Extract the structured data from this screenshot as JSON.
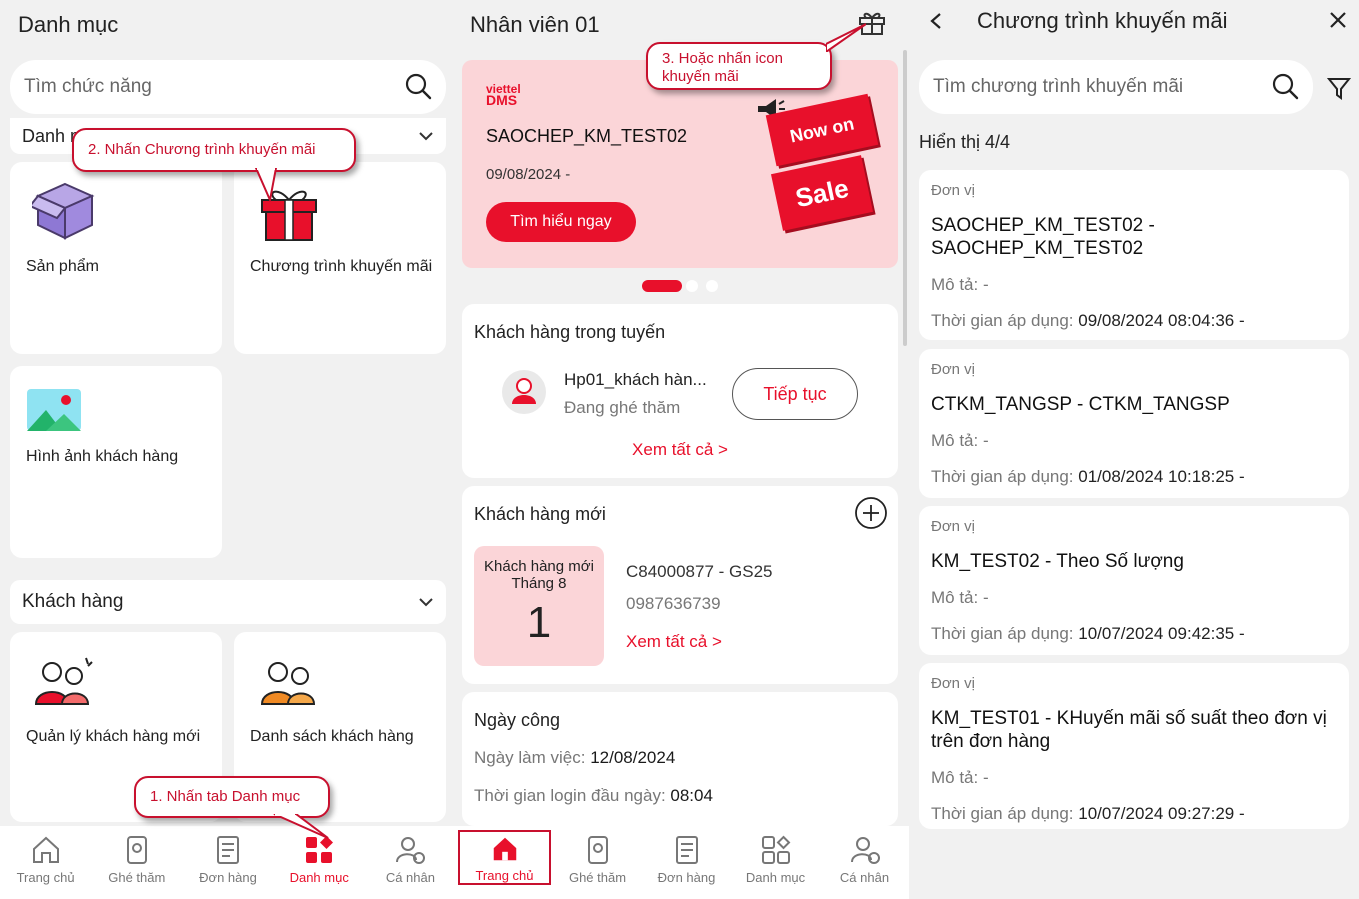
{
  "left": {
    "title": "Danh mục",
    "search_placeholder": "Tìm chức năng",
    "section1_partial": "Danh m",
    "tiles1": [
      {
        "label": "Sản phẩm",
        "icon": "box-icon"
      },
      {
        "label": "Chương trình khuyến mãi",
        "icon": "gift-icon"
      },
      {
        "label": "Hình ảnh khách hàng",
        "icon": "image-icon"
      }
    ],
    "section2": "Khách hàng",
    "tiles2": [
      {
        "label": "Quản lý khách hàng mới",
        "icon": "users-new-icon"
      },
      {
        "label": "Danh sách khách hàng",
        "icon": "users-list-icon"
      }
    ],
    "callout_step1": "1.  Nhấn tab Danh mục",
    "callout_step2": "2. Nhấn Chương trình khuyến mãi",
    "tabs": [
      {
        "label": "Trang chủ"
      },
      {
        "label": "Ghé thăm"
      },
      {
        "label": "Đơn hàng"
      },
      {
        "label": "Danh mục"
      },
      {
        "label": "Cá nhân"
      }
    ]
  },
  "middle": {
    "title": "Nhân viên 01",
    "callout_step3": "3. Hoặc nhấn icon khuyến mãi",
    "banner": {
      "brand_top": "viettel",
      "brand_bottom": "DMS",
      "promo_code": "SAOCHEP_KM_TEST02",
      "date": "09/08/2024 -",
      "button": "Tìm hiểu ngay",
      "badge_top": "Now on",
      "badge_bottom": "Sale"
    },
    "route": {
      "title": "Khách hàng trong tuyến",
      "customer": "Hp01_khách hàn...",
      "status": "Đang ghé thăm",
      "continue": "Tiếp tục",
      "see_all": "Xem tất cả >"
    },
    "new_customers": {
      "title": "Khách hàng mới",
      "box_label_1": "Khách hàng mới",
      "box_label_2": "Tháng 8",
      "count": "1",
      "code": "C84000877 - GS25",
      "phone": "0987636739",
      "see_all": "Xem tất cả >"
    },
    "workday": {
      "title": "Ngày công",
      "line1_label": "Ngày làm việc: ",
      "line1_value": "12/08/2024",
      "line2_label": "Thời gian login đầu ngày: ",
      "line2_value": "08:04"
    },
    "tabs": [
      {
        "label": "Trang chủ"
      },
      {
        "label": "Ghé thăm"
      },
      {
        "label": "Đơn hàng"
      },
      {
        "label": "Danh mục"
      },
      {
        "label": "Cá nhân"
      }
    ]
  },
  "right": {
    "title": "Chương trình khuyến mãi",
    "search_placeholder": "Tìm chương trình khuyến mãi",
    "count_text": "Hiển thị 4/4",
    "unit_label": "Đơn vị",
    "desc_label": "Mô tả: -",
    "time_label": "Thời gian áp dụng: ",
    "items": [
      {
        "name": "SAOCHEP_KM_TEST02 - SAOCHEP_KM_TEST02",
        "time": "09/08/2024 08:04:36 -"
      },
      {
        "name": "CTKM_TANGSP - CTKM_TANGSP",
        "time": "01/08/2024 10:18:25 -"
      },
      {
        "name": "KM_TEST02 - Theo Số lượng",
        "time": "10/07/2024 09:42:35 -"
      },
      {
        "name": "KM_TEST01 - KHuyến mãi số suất theo đơn vị trên đơn hàng",
        "time": "10/07/2024 09:27:29 -"
      }
    ]
  },
  "colors": {
    "accent": "#e8102b",
    "callout": "#c8102e",
    "banner_bg": "#fbd5d8"
  }
}
